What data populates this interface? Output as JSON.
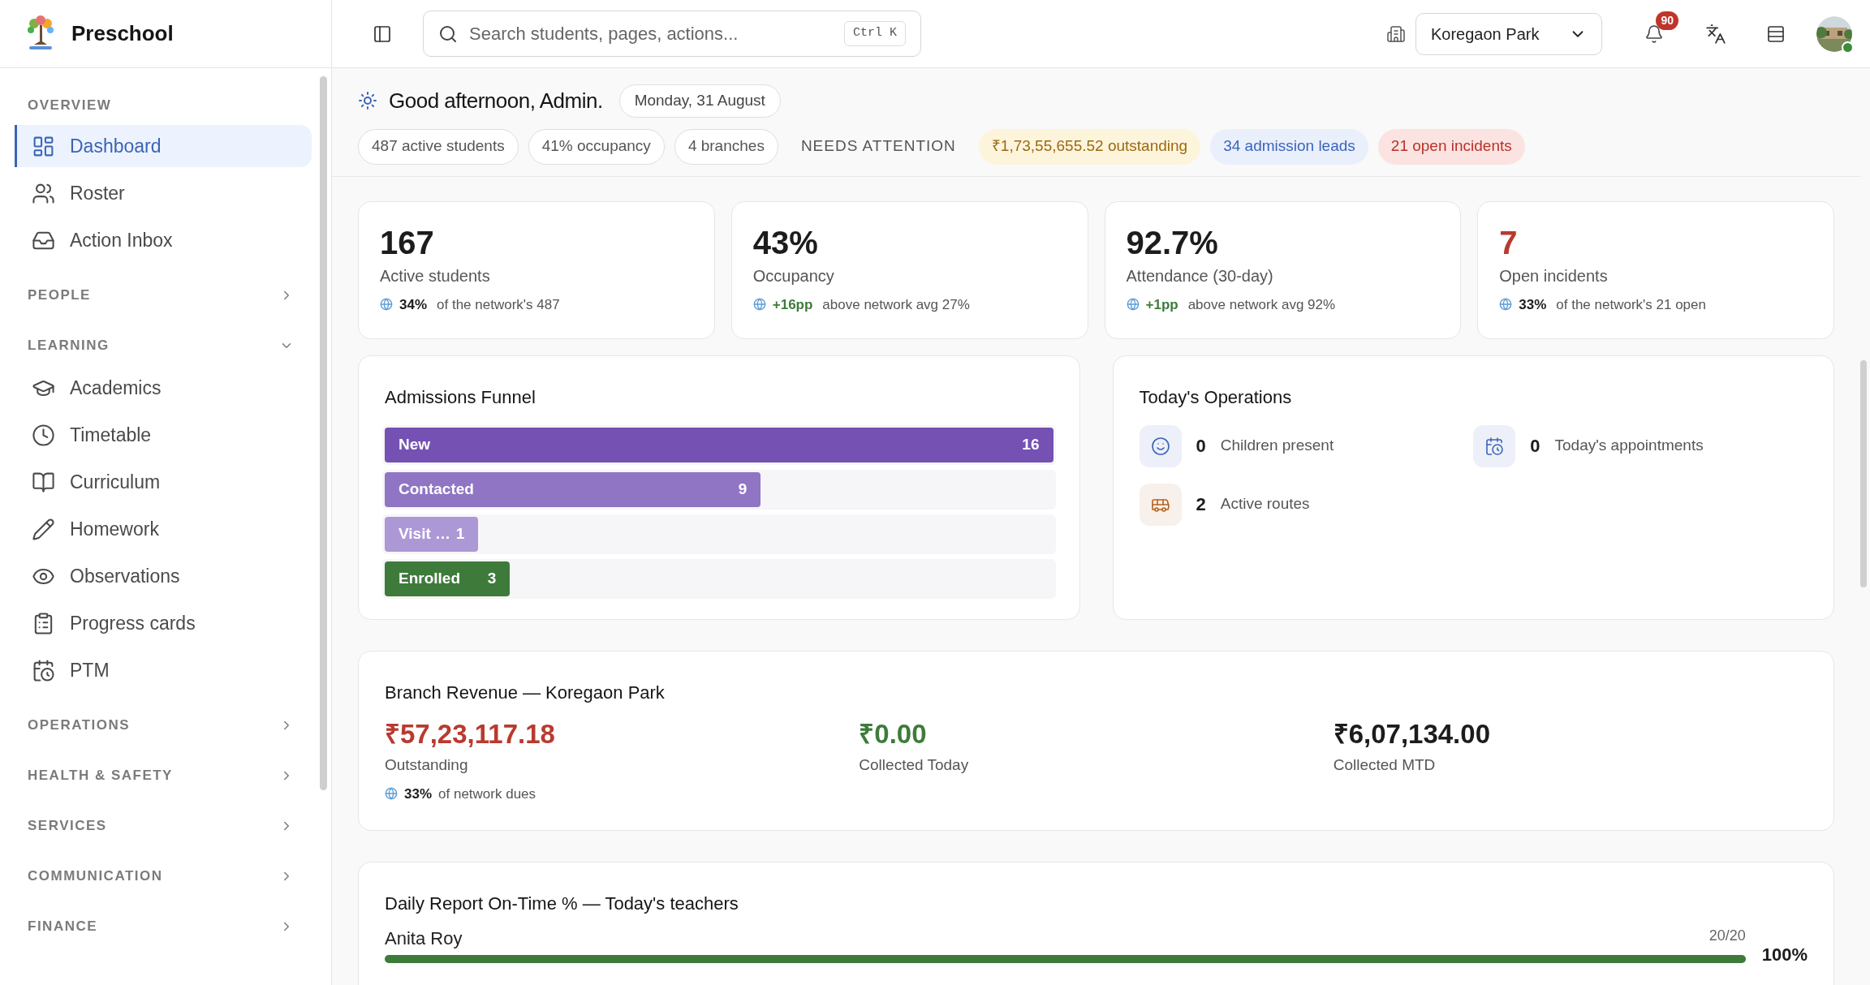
{
  "brand": {
    "name": "Preschool"
  },
  "sidebar": {
    "sections": [
      {
        "title": "OVERVIEW",
        "kind": "static",
        "items": [
          {
            "label": "Dashboard",
            "selected": true
          },
          {
            "label": "Roster",
            "selected": false
          },
          {
            "label": "Action Inbox",
            "selected": false
          }
        ]
      },
      {
        "title": "PEOPLE",
        "kind": "collapsible",
        "expanded": false
      },
      {
        "title": "LEARNING",
        "kind": "collapsible",
        "expanded": true,
        "items": [
          {
            "label": "Academics",
            "selected": false
          },
          {
            "label": "Timetable",
            "selected": false
          },
          {
            "label": "Curriculum",
            "selected": false
          },
          {
            "label": "Homework",
            "selected": false
          },
          {
            "label": "Observations",
            "selected": false
          },
          {
            "label": "Progress cards",
            "selected": false
          },
          {
            "label": "PTM",
            "selected": false
          }
        ]
      },
      {
        "title": "OPERATIONS",
        "kind": "collapsible",
        "expanded": false
      },
      {
        "title": "HEALTH & SAFETY",
        "kind": "collapsible",
        "expanded": false
      },
      {
        "title": "SERVICES",
        "kind": "collapsible",
        "expanded": false
      },
      {
        "title": "COMMUNICATION",
        "kind": "collapsible",
        "expanded": false
      },
      {
        "title": "FINANCE",
        "kind": "collapsible",
        "expanded": false
      }
    ]
  },
  "topbar": {
    "search": {
      "placeholder": "Search students, pages, actions...",
      "shortcut": "Ctrl K"
    },
    "branch_select": {
      "value": "Koregaon Park"
    },
    "notifications": {
      "count": "90"
    }
  },
  "greeting": {
    "text": "Good afternoon, Admin.",
    "date": "Monday, 31 August"
  },
  "chips": [
    {
      "text": "487 active students",
      "kind": "neutral"
    },
    {
      "text": "41% occupancy",
      "kind": "neutral"
    },
    {
      "text": "4 branches",
      "kind": "neutral"
    },
    {
      "text": "NEEDS ATTENTION",
      "kind": "label"
    },
    {
      "text": "₹1,73,55,655.52 outstanding",
      "kind": "warning"
    },
    {
      "text": "34 admission leads",
      "kind": "info"
    },
    {
      "text": "21 open incidents",
      "kind": "danger"
    }
  ],
  "stats": [
    {
      "value": "167",
      "color": "#1c1c1c",
      "label": "Active students",
      "delta": {
        "text": "34%",
        "color": "#1c1c1c"
      },
      "note": "of the network's 487"
    },
    {
      "value": "43%",
      "color": "#1c1c1c",
      "label": "Occupancy",
      "delta": {
        "text": "+16pp",
        "color": "#3e7b3b"
      },
      "note": "above network avg 27%"
    },
    {
      "value": "92.7%",
      "color": "#1c1c1c",
      "label": "Attendance (30-day)",
      "delta": {
        "text": "+1pp",
        "color": "#3e7b3b"
      },
      "note": "above network avg 92%"
    },
    {
      "value": "7",
      "color": "#b93a2f",
      "label": "Open incidents",
      "delta": {
        "text": "33%",
        "color": "#1c1c1c"
      },
      "note": "of the network's 21 open"
    }
  ],
  "admissions_funnel": {
    "title": "Admissions Funnel",
    "stages": [
      {
        "label": "New",
        "value": "16",
        "level": 1,
        "color": "#7451b3"
      },
      {
        "label": "Contacted",
        "value": "9",
        "level": 0.5625,
        "color": "#9075c4"
      },
      {
        "label": "Visit …",
        "value": "1",
        "level": 0.14,
        "color": "#ad98d6"
      },
      {
        "label": "Enrolled",
        "value": "3",
        "level": 0.1875,
        "color": "#3e7b3b"
      }
    ]
  },
  "todays_operations": {
    "title": "Today's Operations",
    "items": [
      {
        "value": "0",
        "label": "Children present",
        "color": "#3b64b8"
      },
      {
        "value": "0",
        "label": "Today's appointments",
        "color": "#3b64b8"
      },
      {
        "value": "2",
        "label": "Active routes",
        "color": "#b5601c"
      }
    ]
  },
  "branch_revenue": {
    "title": "Branch Revenue — Koregaon Park",
    "items": [
      {
        "amount": "₹57,23,117.18",
        "label": "Outstanding",
        "color": "#b93a2f",
        "share": "33%",
        "share_note": "of network dues"
      },
      {
        "amount": "₹0.00",
        "label": "Collected Today",
        "color": "#3e7b3b"
      },
      {
        "amount": "₹6,07,134.00",
        "label": "Collected MTD",
        "color": "#1c1c1c"
      }
    ]
  },
  "daily_report": {
    "title": "Daily Report On-Time % — Today's teachers",
    "rows": [
      {
        "name": "Anita Roy",
        "count": "20/20",
        "percent": "100%",
        "level": 1
      }
    ]
  }
}
